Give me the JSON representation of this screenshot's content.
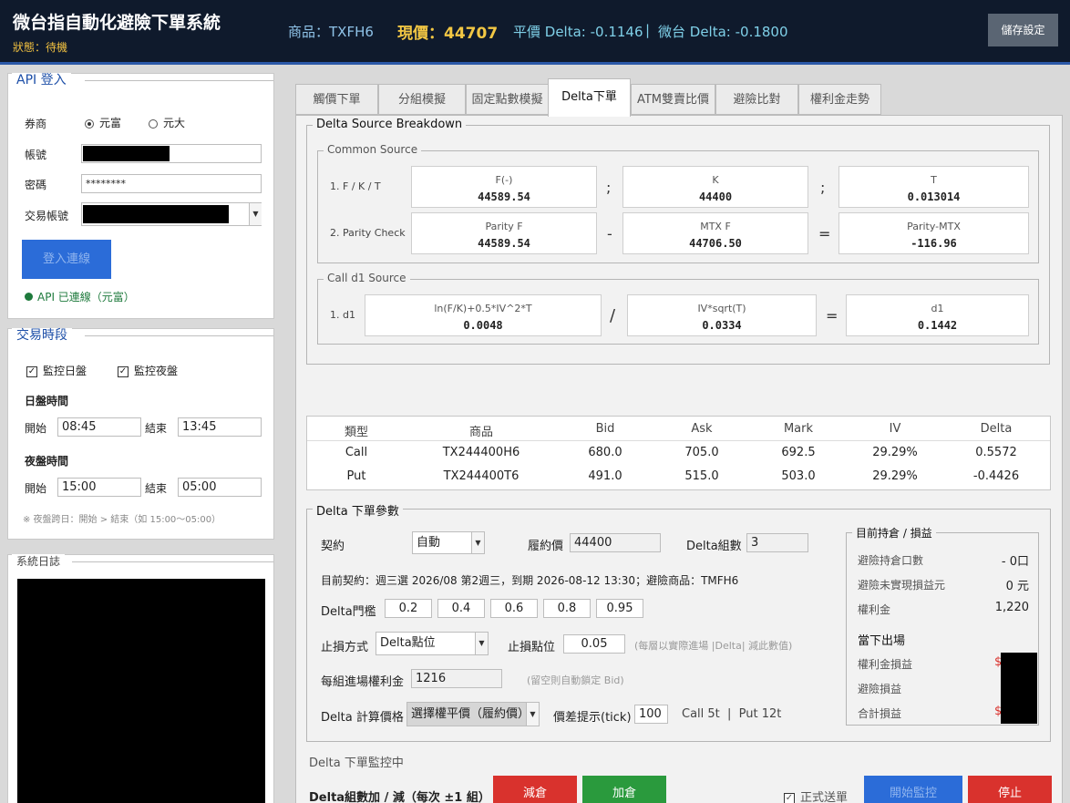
{
  "header": {
    "title": "微台指自動化避險下單系統",
    "status": "狀態：待機",
    "product": "商品：TXFH6",
    "price_label": "現價：",
    "price": "44707",
    "parity_delta": "平價 Delta: -0.1146",
    "separator": "|",
    "mtx_delta": "微台 Delta: -0.1800",
    "save_button": "儲存設定"
  },
  "api_login": {
    "title": "API 登入",
    "broker_label": "券商",
    "broker_options": [
      "元富",
      "元大"
    ],
    "account_label": "帳號",
    "password_label": "密碼",
    "password_value": "********",
    "trade_account_label": "交易帳號",
    "login_button": "登入連線",
    "status": "API 已連線（元富）"
  },
  "trading_session": {
    "title": "交易時段",
    "monitor_day": "監控日盤",
    "monitor_night": "監控夜盤",
    "day_title": "日盤時間",
    "day_start_label": "開始",
    "day_start": "08:45",
    "day_end_label": "結束",
    "day_end": "13:45",
    "night_title": "夜盤時間",
    "night_start_label": "開始",
    "night_start": "15:00",
    "night_end_label": "結束",
    "night_end": "05:00",
    "note": "※ 夜盤跨日：開始 > 結束（如 15:00～05:00）"
  },
  "system_log": {
    "title": "系統日誌"
  },
  "tabs": [
    "觸價下單",
    "分組模擬",
    "固定點數模擬",
    "Delta下單",
    "ATM雙賣比價",
    "避險比對",
    "權利金走勢"
  ],
  "breakdown": {
    "title": "Delta Source Breakdown",
    "common_title": "Common Source",
    "row1_label": "1. F / K / T",
    "row1": [
      {
        "name": "F(-)",
        "value": "44589.54"
      },
      {
        "name": "K",
        "value": "44400"
      },
      {
        "name": "T",
        "value": "0.013014"
      }
    ],
    "row1_ops": [
      ";",
      ";"
    ],
    "row2_label": "2. Parity Check",
    "row2": [
      {
        "name": "Parity F",
        "value": "44589.54"
      },
      {
        "name": "MTX F",
        "value": "44706.50"
      },
      {
        "name": "Parity-MTX",
        "value": "-116.96"
      }
    ],
    "row2_ops": [
      "-",
      "="
    ],
    "call_title": "Call d1 Source",
    "row3_label": "1. d1",
    "row3": [
      {
        "name": "ln(F/K)+0.5*IV^2*T",
        "value": "0.0048"
      },
      {
        "name": "IV*sqrt(T)",
        "value": "0.0334"
      },
      {
        "name": "d1",
        "value": "0.1442"
      }
    ],
    "row3_ops": [
      "/",
      "="
    ]
  },
  "options_table": {
    "headers": [
      "類型",
      "商品",
      "Bid",
      "Ask",
      "Mark",
      "IV",
      "Delta"
    ],
    "rows": [
      [
        "Call",
        "TX244400H6",
        "680.0",
        "705.0",
        "692.5",
        "29.29%",
        "0.5572"
      ],
      [
        "Put",
        "TX244400T6",
        "491.0",
        "515.0",
        "503.0",
        "29.29%",
        "-0.4426"
      ]
    ]
  },
  "order_params": {
    "title": "Delta 下單參數",
    "contract_label": "契約",
    "contract_value": "自動",
    "strike_label": "履約價",
    "strike_value": "44400",
    "groups_label": "Delta組數",
    "groups_value": "3",
    "current_contract": "目前契約：週三選 2026/08 第2週三，到期 2026-08-12 13:30；避險商品：TMFH6",
    "threshold_label": "Delta門檻",
    "thresholds": [
      "0.2",
      "0.4",
      "0.6",
      "0.8",
      "0.95"
    ],
    "stop_method_label": "止損方式",
    "stop_method_value": "Delta點位",
    "stop_points_label": "止損點位",
    "stop_points_value": "0.05",
    "stop_note": "(每層以實際進場 |Delta| 減此數值)",
    "premium_label": "每組進場權利金",
    "premium_value": "1216",
    "premium_note": "(留空則自動鎖定 Bid)",
    "calc_price_label": "Delta 計算價格",
    "calc_price_value": "選擇權平價（履約價）",
    "spread_label": "價差提示(tick)",
    "spread_value": "100",
    "spread_info": "Call 5t  |  Put 12t"
  },
  "position": {
    "title": "目前持倉 / 損益",
    "hedge_lots_label": "避險持倉口數",
    "hedge_lots_value": "- 0口",
    "unrealized_label": "避險未實現損益元",
    "unrealized_value": "0 元",
    "premium_label": "權利金",
    "premium_value": "1,220",
    "exit_title": "當下出場",
    "premium_pl_label": "權利金損益",
    "hedge_pl_label": "避險損益",
    "total_pl_label": "合計損益",
    "currency_mark": "$"
  },
  "monitor": {
    "status": "Delta 下單監控中",
    "adjust_label": "Delta組數加 / 減（每次 ±1 組）",
    "decrease_button": "減倉",
    "increase_button": "加倉",
    "live_order_label": "正式送單",
    "start_button": "開始監控",
    "stop_button": "停止"
  },
  "colors": {
    "header_bg": "#0f1a2c",
    "accent_blue": "#2b6cd8",
    "price_gold": "#f2c744",
    "delta_cyan": "#7fd0e8",
    "red_button": "#d9322d",
    "green_button": "#2a9a3d",
    "connected_green": "#1e7a3c"
  }
}
